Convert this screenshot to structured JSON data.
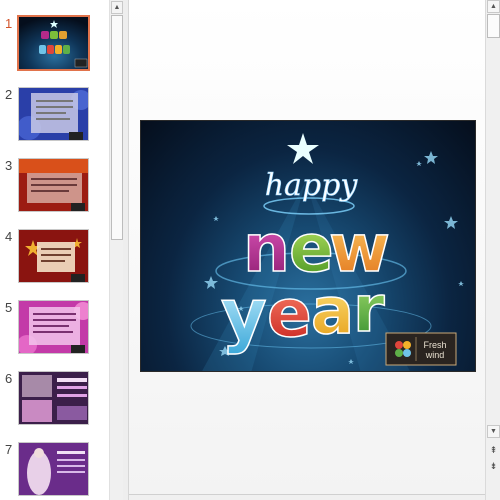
{
  "thumbnails": [
    {
      "number": "1",
      "selected": true
    },
    {
      "number": "2",
      "selected": false
    },
    {
      "number": "3",
      "selected": false
    },
    {
      "number": "4",
      "selected": false
    },
    {
      "number": "5",
      "selected": false
    },
    {
      "number": "6",
      "selected": false
    },
    {
      "number": "7",
      "selected": false
    }
  ],
  "slide": {
    "happy": "happy",
    "new": "new",
    "year": "year",
    "logo_line1": "Fresh",
    "logo_line2": "wind"
  },
  "scrollbars": {
    "up_glyph": "▲",
    "down_glyph": "▼",
    "prev_slide_glyph": "⇞",
    "next_slide_glyph": "⇟"
  },
  "colors": {
    "selected_thumb_border": "#e1734b",
    "selected_number": "#d2542b",
    "slide_background": "#0b2542"
  }
}
